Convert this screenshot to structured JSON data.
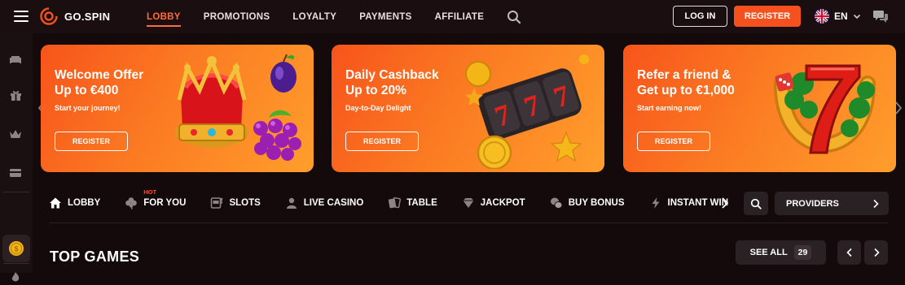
{
  "header": {
    "logo_text": "GO.SPIN",
    "nav": [
      {
        "label": "LOBBY",
        "active": true
      },
      {
        "label": "PROMOTIONS",
        "active": false
      },
      {
        "label": "LOYALTY",
        "active": false
      },
      {
        "label": "PAYMENTS",
        "active": false
      },
      {
        "label": "AFFILIATE",
        "active": false
      }
    ],
    "login_label": "LOG IN",
    "register_label": "REGISTER",
    "language": "EN",
    "accent": "#f4511e"
  },
  "banners": [
    {
      "title": "Welcome Offer\nUp to €400",
      "subtitle": "Start your journey!",
      "button": "REGISTER",
      "art": "crown-plum-grapes"
    },
    {
      "title": "Daily Cashback\nUp to 20%",
      "subtitle": "Day-to-Day Delight",
      "button": "REGISTER",
      "art": "slot-reel-777-coins"
    },
    {
      "title": "Refer a friend &\nGet up to €1,000",
      "subtitle": "Start earning now!",
      "button": "REGISTER",
      "art": "lucky-seven-horseshoe-dice"
    }
  ],
  "categories": [
    {
      "label": "LOBBY",
      "icon": "home-icon",
      "badge": ""
    },
    {
      "label": "FOR YOU",
      "icon": "clover-icon",
      "badge": "HOT"
    },
    {
      "label": "SLOTS",
      "icon": "slot-machine-icon",
      "badge": ""
    },
    {
      "label": "LIVE CASINO",
      "icon": "dealer-icon",
      "badge": ""
    },
    {
      "label": "TABLE",
      "icon": "cards-icon",
      "badge": ""
    },
    {
      "label": "JACKPOT",
      "icon": "diamond-icon",
      "badge": ""
    },
    {
      "label": "BUY BONUS",
      "icon": "coins-icon",
      "badge": ""
    },
    {
      "label": "INSTANT WIN",
      "icon": "lightning-icon",
      "badge": ""
    }
  ],
  "providers_label": "PROVIDERS",
  "section": {
    "title": "TOP GAMES",
    "see_all_label": "SEE ALL",
    "count": "29"
  }
}
